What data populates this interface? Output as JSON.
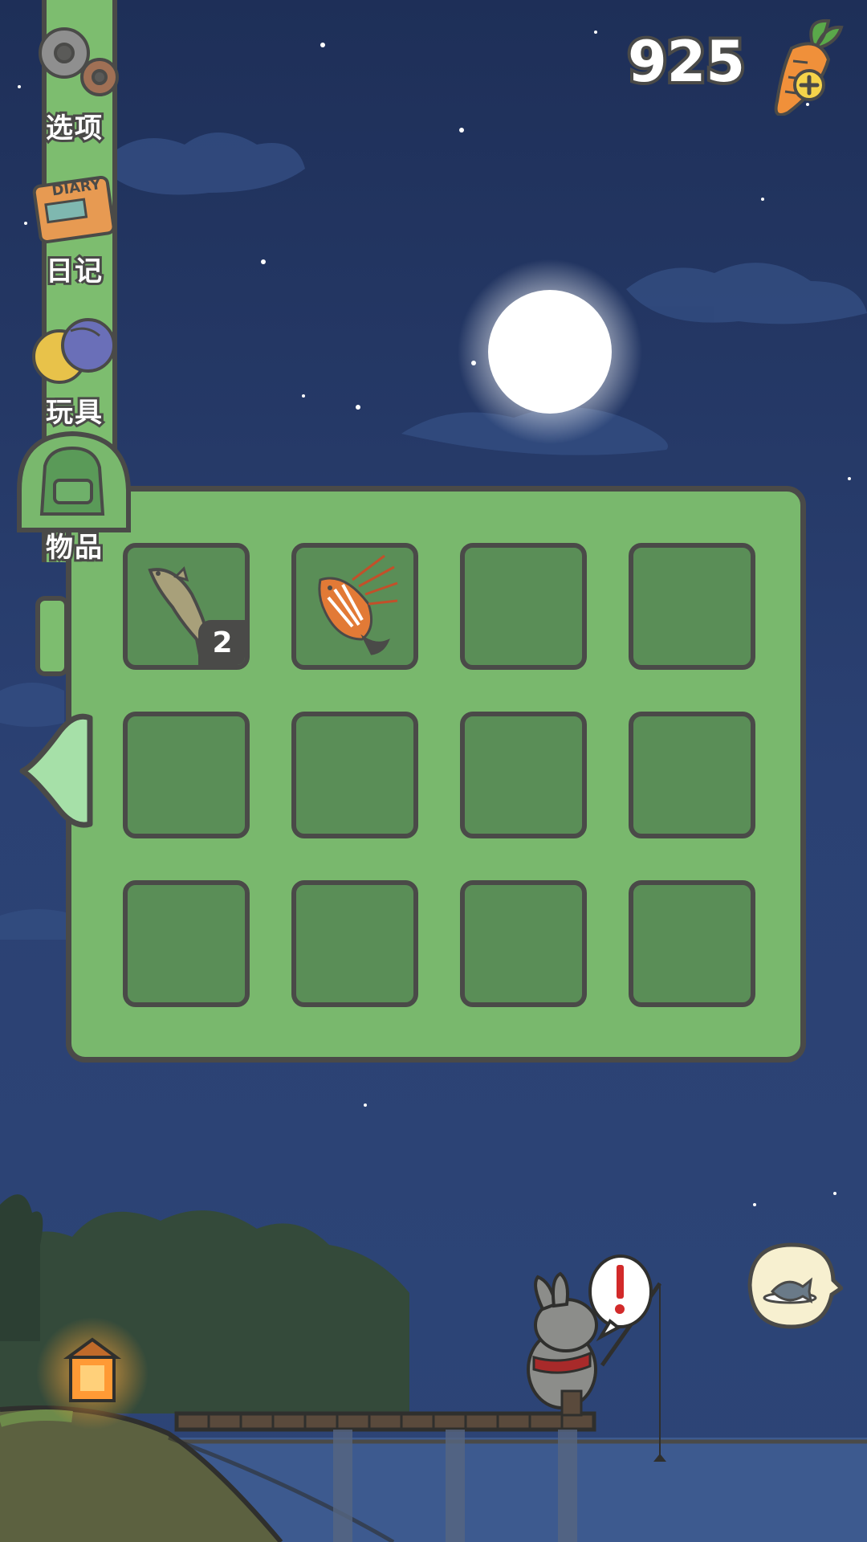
{
  "currency": {
    "value": "925",
    "icon": "carrot-plus-icon"
  },
  "sidebar": {
    "items": [
      {
        "label": "选项",
        "icon": "gears-icon"
      },
      {
        "label": "日记",
        "icon": "diary-icon"
      },
      {
        "label": "玩具",
        "icon": "toy-balls-icon"
      },
      {
        "label": "物品",
        "icon": "backpack-icon",
        "active": true
      }
    ],
    "diary_cover_text": "DIARY"
  },
  "inventory": {
    "slots": [
      {
        "item": "fish",
        "count": "2"
      },
      {
        "item": "lionfish"
      },
      {},
      {},
      {},
      {},
      {},
      {},
      {},
      {},
      {},
      {}
    ]
  },
  "scene": {
    "alert_icon": "exclamation-icon",
    "fish_bubble_icon": "fish-plate-icon"
  },
  "colors": {
    "panel": "#79b86d",
    "slot": "#5a8e57",
    "outline": "#4a4a48",
    "sky": "#233764"
  }
}
